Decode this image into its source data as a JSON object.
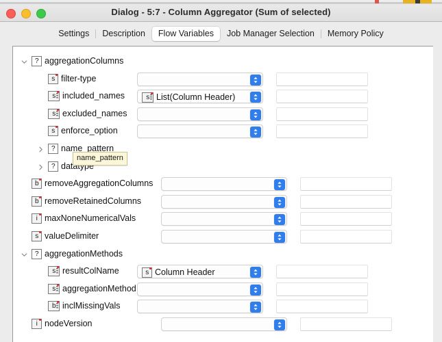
{
  "window": {
    "title": "Dialog - 5:7 - Column Aggregator (Sum of selected)",
    "traffic_lights": [
      "close-button",
      "minimize-button",
      "maximize-button"
    ]
  },
  "tabs": [
    {
      "label": "Settings",
      "active": false
    },
    {
      "label": "Description",
      "active": false
    },
    {
      "label": "Flow Variables",
      "active": true
    },
    {
      "label": "Job Manager Selection",
      "active": false
    },
    {
      "label": "Memory Policy",
      "active": false
    }
  ],
  "tooltip": {
    "text": "name_pattern"
  },
  "colors": {
    "accent": "#2f7eec",
    "tooltip_bg": "#fbf7d8",
    "panel_bg": "#ffffff",
    "window_bg": "#ececec",
    "icon_dot": "#e02020"
  },
  "tree": {
    "rows": [
      {
        "name": "aggregationColumns",
        "icon": "question",
        "icon_label": "?",
        "depth": 0,
        "expander": "down",
        "has_combo": false,
        "has_field": false,
        "value": ""
      },
      {
        "name": "filter-type",
        "icon": "string",
        "icon_label": "s",
        "depth": 1,
        "expander": "none",
        "has_combo": true,
        "has_field": true,
        "value": ""
      },
      {
        "name": "included_names",
        "icon": "string-list",
        "icon_label": "sl",
        "depth": 1,
        "expander": "none",
        "has_combo": true,
        "has_field": true,
        "value": "List(Column Header)",
        "value_icon": "string-list"
      },
      {
        "name": "excluded_names",
        "icon": "string-list",
        "icon_label": "sl",
        "depth": 1,
        "expander": "none",
        "has_combo": true,
        "has_field": true,
        "value": ""
      },
      {
        "name": "enforce_option",
        "icon": "string",
        "icon_label": "s",
        "depth": 1,
        "expander": "none",
        "has_combo": true,
        "has_field": true,
        "value": ""
      },
      {
        "name": "name_pattern",
        "icon": "question",
        "icon_label": "?",
        "depth": 1,
        "expander": "right",
        "has_combo": false,
        "has_field": false,
        "value": ""
      },
      {
        "name": "datatype",
        "icon": "question",
        "icon_label": "?",
        "depth": 1,
        "expander": "right",
        "has_combo": false,
        "has_field": false,
        "value": ""
      },
      {
        "name": "removeAggregationColumns",
        "icon": "boolean",
        "icon_label": "b",
        "depth": 0,
        "expander": "none",
        "has_combo": true,
        "has_field": true,
        "value": ""
      },
      {
        "name": "removeRetainedColumns",
        "icon": "boolean",
        "icon_label": "b",
        "depth": 0,
        "expander": "none",
        "has_combo": true,
        "has_field": true,
        "value": ""
      },
      {
        "name": "maxNoneNumericalVals",
        "icon": "integer",
        "icon_label": "i",
        "depth": 0,
        "expander": "none",
        "has_combo": true,
        "has_field": true,
        "value": ""
      },
      {
        "name": "valueDelimiter",
        "icon": "string",
        "icon_label": "s",
        "depth": 0,
        "expander": "none",
        "has_combo": true,
        "has_field": true,
        "value": ""
      },
      {
        "name": "aggregationMethods",
        "icon": "question",
        "icon_label": "?",
        "depth": 0,
        "expander": "down",
        "has_combo": false,
        "has_field": false,
        "value": ""
      },
      {
        "name": "resultColName",
        "icon": "string-list",
        "icon_label": "sl",
        "depth": 1,
        "expander": "none",
        "has_combo": true,
        "has_field": true,
        "value": "Column Header",
        "value_icon": "string"
      },
      {
        "name": "aggregationMethod",
        "icon": "string-list",
        "icon_label": "sl",
        "depth": 1,
        "expander": "none",
        "has_combo": true,
        "has_field": true,
        "value": ""
      },
      {
        "name": "inclMissingVals",
        "icon": "boolean-list",
        "icon_label": "bl",
        "depth": 1,
        "expander": "none",
        "has_combo": true,
        "has_field": true,
        "value": ""
      },
      {
        "name": "nodeVersion",
        "icon": "integer",
        "icon_label": "i",
        "depth": 0,
        "expander": "none",
        "has_combo": true,
        "has_field": true,
        "value": ""
      }
    ]
  }
}
